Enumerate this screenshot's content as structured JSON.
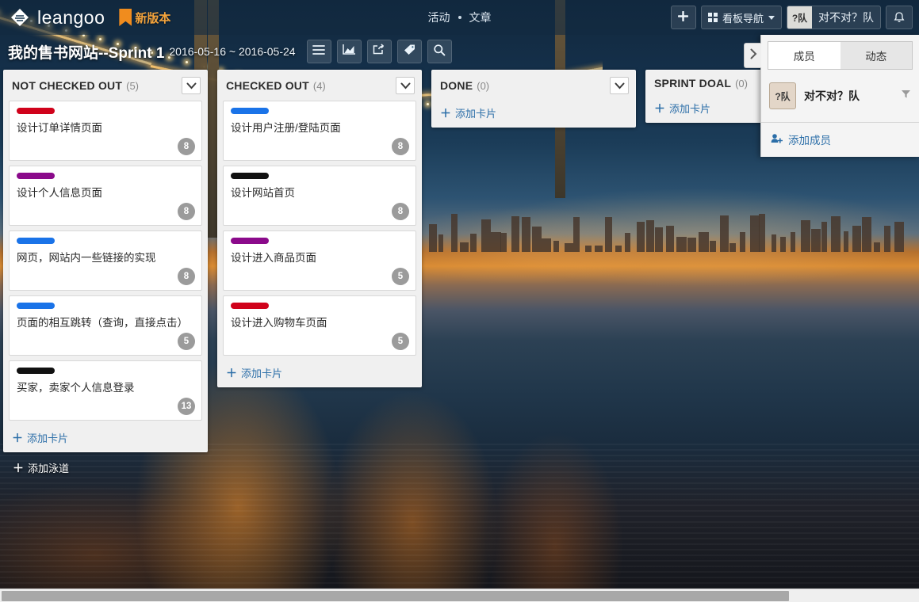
{
  "topbar": {
    "logo_text": "leangoo",
    "logo_icon": "leangoo-diamond-logo",
    "new_version_label": "新版本",
    "bookmark_icon": "bookmark-icon",
    "nav": {
      "activity": "活动",
      "article": "文章"
    },
    "add_button_icon": "plus-icon",
    "board_nav_label": "看板导航",
    "board_nav_icon": "grid-icon",
    "user_initials": "?队",
    "user_name": "对不对？队",
    "bell_icon": "bell-icon"
  },
  "boardbar": {
    "title": "我的售书网站--Sprint 1",
    "dates": "2016-05-16 ~ 2016-05-24",
    "tools": [
      {
        "name": "menu-icon",
        "title": "菜单"
      },
      {
        "name": "chart-icon",
        "title": "燃尽图"
      },
      {
        "name": "share-icon",
        "title": "分享"
      },
      {
        "name": "tag-icon",
        "title": "标签"
      },
      {
        "name": "search-icon",
        "title": "搜索"
      }
    ]
  },
  "board": {
    "add_swimlane_label": "添加泳道",
    "add_card_label": "添加卡片",
    "lists": [
      {
        "title": "NOT CHECKED OUT",
        "count": "(5)",
        "cards": [
          {
            "label_color": "#d0021b",
            "title": "设计订单详情页面",
            "points": "8"
          },
          {
            "label_color": "#8b0a8b",
            "title": "设计个人信息页面",
            "points": "8"
          },
          {
            "label_color": "#1a73e8",
            "title": "网页，网站内一些链接的实现",
            "points": "8"
          },
          {
            "label_color": "#1a73e8",
            "title": "页面的相互跳转（查询，直接点击）",
            "points": "5"
          },
          {
            "label_color": "#111111",
            "title": "买家，卖家个人信息登录",
            "points": "13"
          }
        ]
      },
      {
        "title": "CHECKED OUT",
        "count": "(4)",
        "cards": [
          {
            "label_color": "#1a73e8",
            "title": "设计用户注册/登陆页面",
            "points": "8"
          },
          {
            "label_color": "#111111",
            "title": "设计网站首页",
            "points": "8"
          },
          {
            "label_color": "#8b0a8b",
            "title": "设计进入商品页面",
            "points": "5"
          },
          {
            "label_color": "#d0021b",
            "title": "设计进入购物车页面",
            "points": "5"
          }
        ]
      },
      {
        "title": "DONE",
        "count": "(0)",
        "cards": []
      },
      {
        "title": "SPRINT DOAL",
        "count": "(0)",
        "cards": []
      }
    ]
  },
  "right_panel": {
    "toggle_icon": "chevron-right-icon",
    "tabs": [
      {
        "label": "成员",
        "active": true
      },
      {
        "label": "动态",
        "active": false
      }
    ],
    "member": {
      "initials": "?队",
      "name": "对不对？队",
      "filter_icon": "filter-icon"
    },
    "add_member_label": "添加成员",
    "add_member_icon": "add-user-icon"
  },
  "colors": {
    "accent_link": "#2b6ea8",
    "badge_gray": "#9b9b9b",
    "brand_orange": "#f08c1e"
  }
}
